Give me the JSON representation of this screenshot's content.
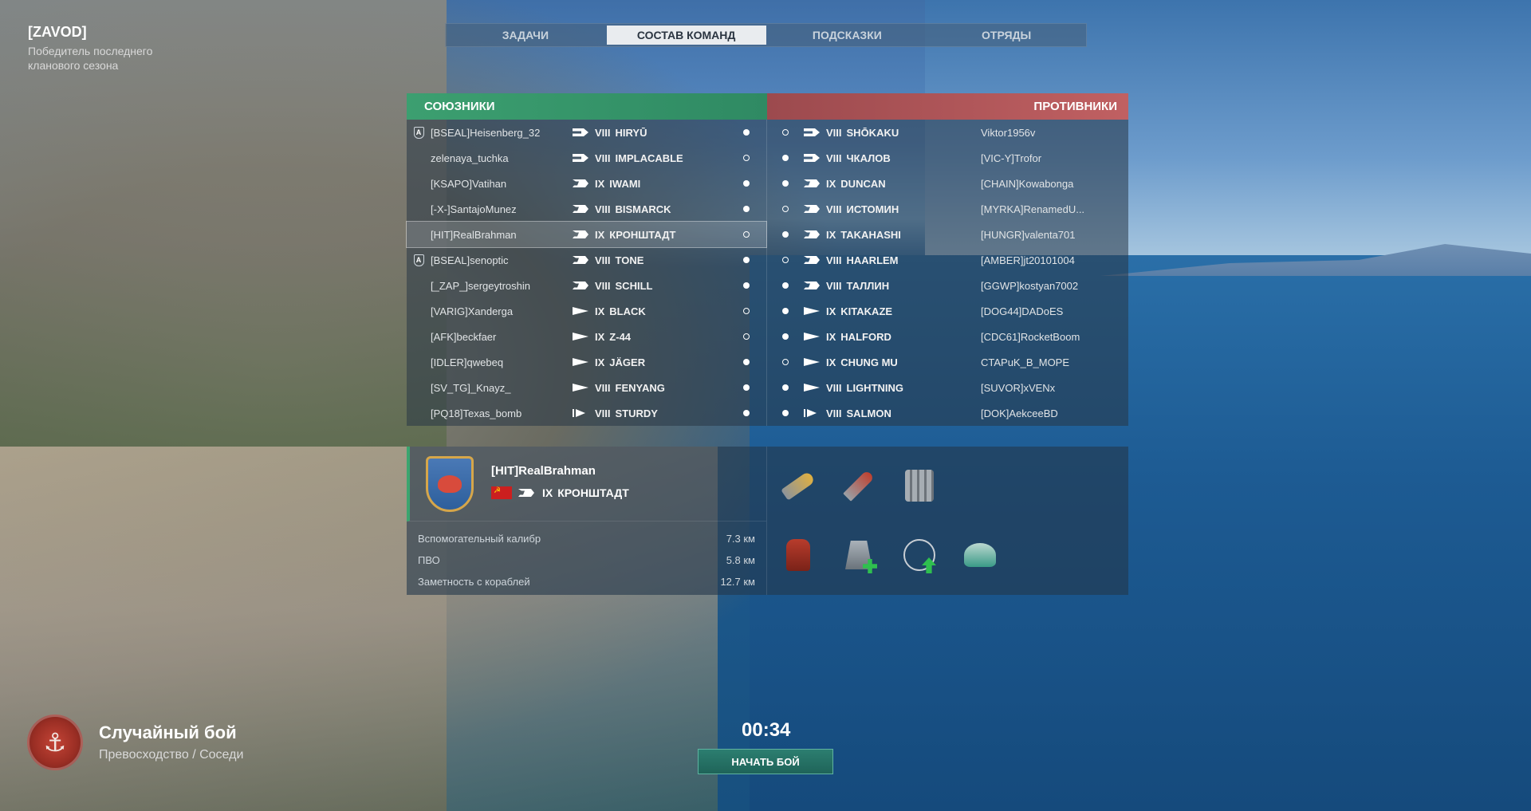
{
  "clan": {
    "tag": "[ZAVOD]",
    "description": "Победитель последнего кланового сезона"
  },
  "tabs": [
    {
      "label": "ЗАДАЧИ",
      "active": false
    },
    {
      "label": "СОСТАВ КОМАНД",
      "active": true
    },
    {
      "label": "ПОДСКАЗКИ",
      "active": false
    },
    {
      "label": "ОТРЯДЫ",
      "active": false
    }
  ],
  "teams": {
    "allies_label": "СОЮЗНИКИ",
    "enemies_label": "ПРОТИВНИКИ",
    "allies": [
      {
        "division": "A",
        "player": "[BSEAL]Heisenberg_32",
        "class": "cv",
        "tier": "VIII",
        "ship": "HIRYŪ",
        "ready": true
      },
      {
        "division": "",
        "player": "zelenaya_tuchka",
        "class": "cv",
        "tier": "VIII",
        "ship": "IMPLACABLE",
        "ready": false
      },
      {
        "division": "",
        "player": "[KSAPO]Vatihan",
        "class": "bb",
        "tier": "IX",
        "ship": "IWAMI",
        "ready": true
      },
      {
        "division": "",
        "player": "[-X-]SantajoMunez",
        "class": "bb",
        "tier": "VIII",
        "ship": "BISMARCK",
        "ready": true
      },
      {
        "division": "",
        "player": "[HIT]RealBrahman",
        "class": "bb",
        "tier": "IX",
        "ship": "КРОНШТАДТ",
        "ready": false,
        "selected": true
      },
      {
        "division": "A",
        "player": "[BSEAL]senoptic",
        "class": "bb",
        "tier": "VIII",
        "ship": "TONE",
        "ready": true
      },
      {
        "division": "",
        "player": "[_ZAP_]sergeytroshin",
        "class": "bb",
        "tier": "VIII",
        "ship": "SCHILL",
        "ready": true
      },
      {
        "division": "",
        "player": "[VARIG]Xanderga",
        "class": "dd",
        "tier": "IX",
        "ship": "BLACK",
        "ready": false
      },
      {
        "division": "",
        "player": "[AFK]beckfaer",
        "class": "dd",
        "tier": "IX",
        "ship": "Z-44",
        "ready": false
      },
      {
        "division": "",
        "player": "[IDLER]qwebeq",
        "class": "dd",
        "tier": "IX",
        "ship": "JÄGER",
        "ready": true
      },
      {
        "division": "",
        "player": "[SV_TG]_Knayz_",
        "class": "dd",
        "tier": "VIII",
        "ship": "FENYANG",
        "ready": true
      },
      {
        "division": "",
        "player": "[PQ18]Texas_bomb",
        "class": "ss",
        "tier": "VIII",
        "ship": "STURDY",
        "ready": true
      }
    ],
    "enemies": [
      {
        "player": "Viktor1956v",
        "class": "cv",
        "tier": "VIII",
        "ship": "SHŌKAKU",
        "ready": false
      },
      {
        "player": "[VIC-Y]Trofor",
        "class": "cv",
        "tier": "VIII",
        "ship": "ЧКАЛОВ",
        "ready": true
      },
      {
        "player": "[CHAIN]Kowabonga",
        "class": "bb",
        "tier": "IX",
        "ship": "DUNCAN",
        "ready": true
      },
      {
        "player": "[MYRKA]RenamedU...",
        "class": "bb",
        "tier": "VIII",
        "ship": "ИСТОМИН",
        "ready": false
      },
      {
        "player": "[HUNGR]valenta701",
        "class": "bb",
        "tier": "IX",
        "ship": "TAKAHASHI",
        "ready": true
      },
      {
        "player": "[AMBER]jt20101004",
        "class": "bb",
        "tier": "VIII",
        "ship": "HAARLEM",
        "ready": false
      },
      {
        "player": "[GGWP]kostyan7002",
        "class": "bb",
        "tier": "VIII",
        "ship": "ТАЛЛИН",
        "ready": true
      },
      {
        "player": "[DOG44]DADoES",
        "class": "dd",
        "tier": "IX",
        "ship": "KITAKAZE",
        "ready": true
      },
      {
        "player": "[CDC61]RocketBoom",
        "class": "dd",
        "tier": "IX",
        "ship": "HALFORD",
        "ready": true
      },
      {
        "player": "CTAPuK_B_MOPE",
        "class": "dd",
        "tier": "IX",
        "ship": "CHUNG MU",
        "ready": false
      },
      {
        "player": "[SUVOR]xVENx",
        "class": "dd",
        "tier": "VIII",
        "ship": "LIGHTNING",
        "ready": true
      },
      {
        "player": "[DOK]AekceeBD",
        "class": "ss",
        "tier": "VIII",
        "ship": "SALMON",
        "ready": true
      }
    ]
  },
  "selected_info": {
    "player": "[HIT]RealBrahman",
    "tier": "IX",
    "ship": "КРОНШТАДТ",
    "stats": [
      {
        "label": "Вспомогательный калибр",
        "value": "7.3 км"
      },
      {
        "label": "ПВО",
        "value": "5.8 км"
      },
      {
        "label": "Заметность с кораблей",
        "value": "12.7 км"
      }
    ],
    "modules_top": [
      "shell-icon",
      "rocket-icon",
      "armor-icon"
    ],
    "modules_bottom": [
      "damage-control-icon",
      "repair-party-icon",
      "fighter-icon",
      "radar-icon"
    ]
  },
  "battle": {
    "mode_title": "Случайный бой",
    "mode_sub": "Превосходство / Соседи",
    "timer": "00:34",
    "start_label": "НАЧАТЬ БОЙ"
  },
  "colors": {
    "allies": "#3c9f70",
    "enemies": "#c06062",
    "start_button": "#2c7e70"
  }
}
